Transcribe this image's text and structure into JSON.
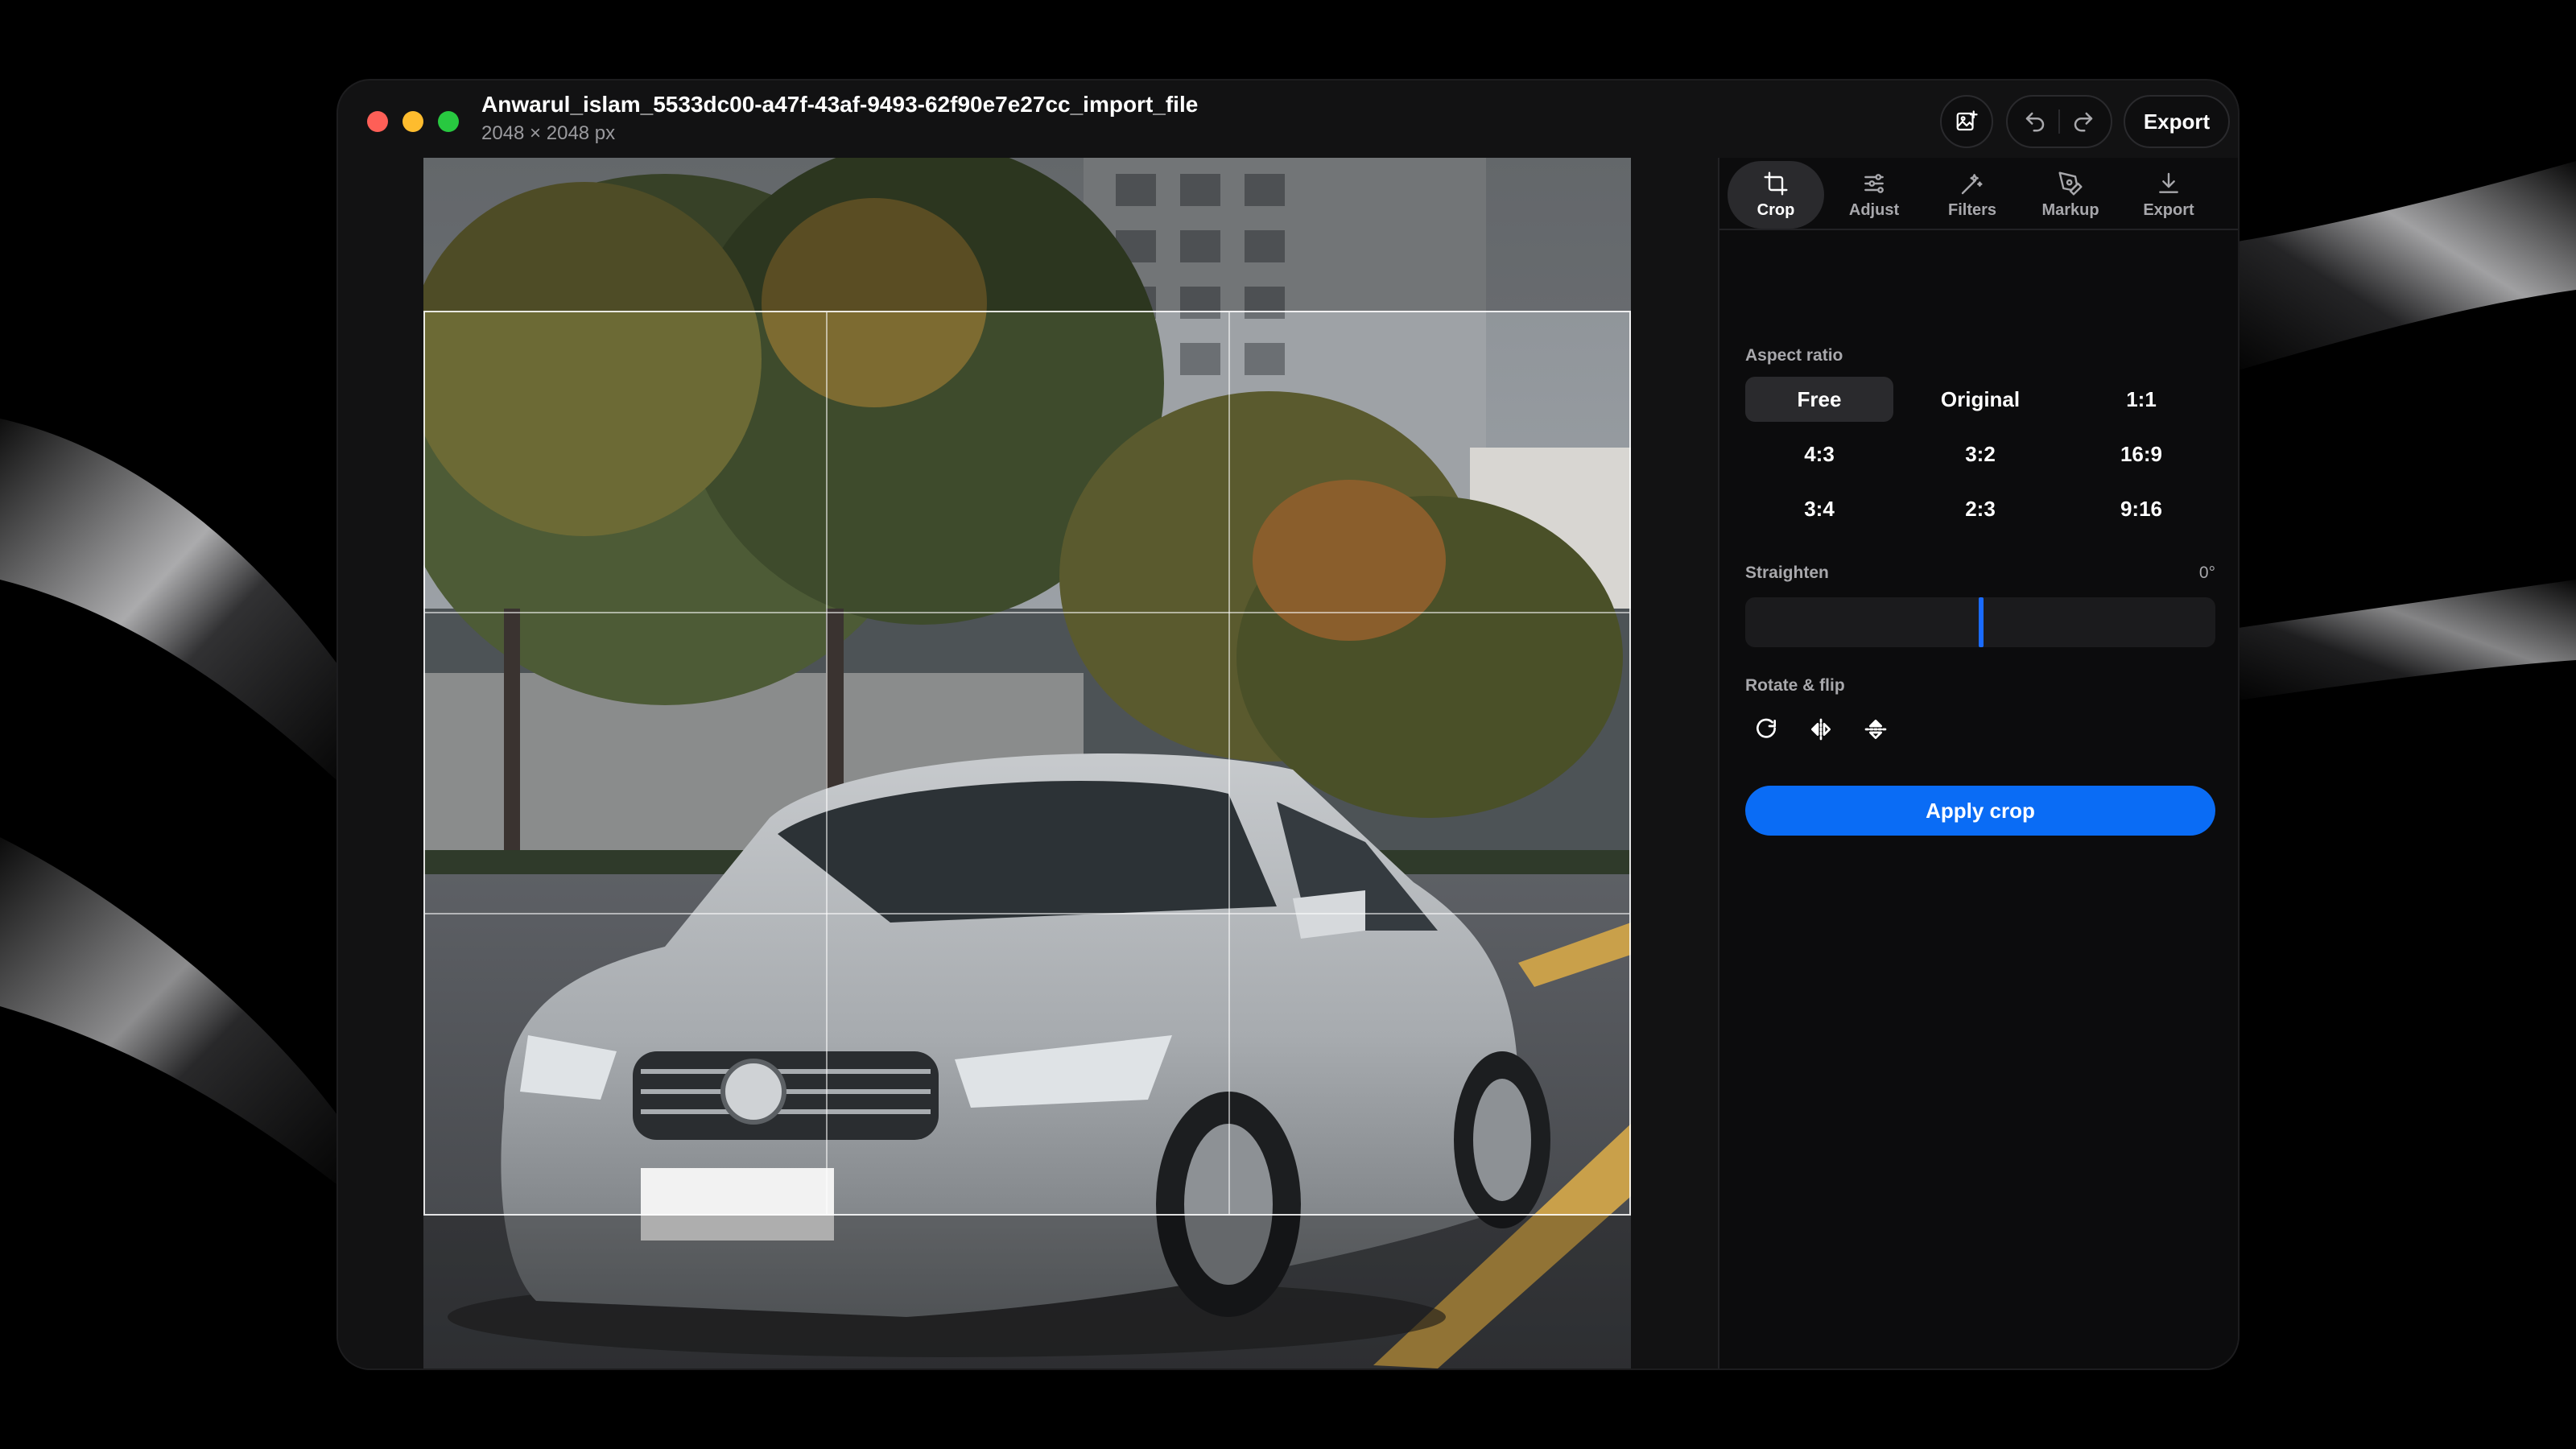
{
  "window": {
    "title": "Anwarul_islam_5533dc00-a47f-43af-9493-62f90e7e27cc_import_file",
    "subtitle": "2048 × 2048 px"
  },
  "toolbar": {
    "add_image_icon": "image-plus-icon",
    "undo_icon": "undo-icon",
    "redo_icon": "redo-icon",
    "export_label": "Export"
  },
  "tabs": [
    {
      "label": "Crop",
      "icon": "crop-icon",
      "active": true
    },
    {
      "label": "Adjust",
      "icon": "sliders-icon",
      "active": false
    },
    {
      "label": "Filters",
      "icon": "magic-wand-icon",
      "active": false
    },
    {
      "label": "Markup",
      "icon": "pen-icon",
      "active": false
    },
    {
      "label": "Export",
      "icon": "download-icon",
      "active": false
    }
  ],
  "crop": {
    "aspect_label": "Aspect ratio",
    "ratios": [
      {
        "label": "Free",
        "active": true
      },
      {
        "label": "Original",
        "active": false
      },
      {
        "label": "1:1",
        "active": false
      },
      {
        "label": "4:3",
        "active": false
      },
      {
        "label": "3:2",
        "active": false
      },
      {
        "label": "16:9",
        "active": false
      },
      {
        "label": "3:4",
        "active": false
      },
      {
        "label": "2:3",
        "active": false
      },
      {
        "label": "9:16",
        "active": false
      }
    ],
    "straighten_label": "Straighten",
    "straighten_value": "0°",
    "rotate_label": "Rotate & flip",
    "rotate_icons": [
      "rotate-cw-icon",
      "flip-horizontal-icon",
      "flip-vertical-icon"
    ],
    "apply_label": "Apply crop"
  },
  "colors": {
    "accent": "#0a6cf5",
    "slider_thumb": "#1a6bff",
    "panel_bg": "#0c0c0d",
    "window_bg": "#121213"
  }
}
